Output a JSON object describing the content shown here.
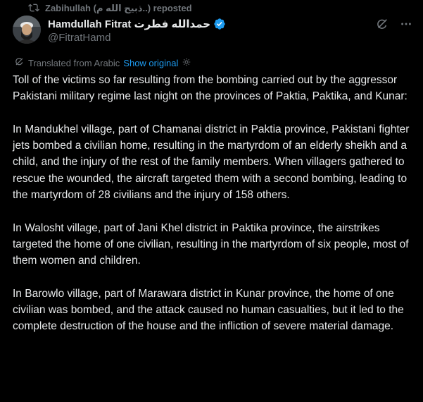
{
  "repost": {
    "text": "Zabihullah (ذبیح الله م..) reposted",
    "icon": "repost-icon"
  },
  "author": {
    "name": "Hamdullah Fitrat حمدالله فطرت",
    "handle": "@FitratHamd",
    "verified": true,
    "verified_color": "#1d9bf0"
  },
  "actions": {
    "grok_icon": "grok-icon",
    "more_icon": "more-icon"
  },
  "translation": {
    "label": "Translated from Arabic",
    "show_original": "Show original",
    "settings_icon": "gear-icon"
  },
  "paragraphs": [
    "Toll of the victims so far resulting from the bombing carried out by the aggressor Pakistani military regime last night on the provinces of Paktia, Paktika, and Kunar:",
    "In Mandukhel village, part of Chamanai district in Paktia province, Pakistani fighter jets bombed a civilian home, resulting in the martyrdom of an elderly sheikh and a child, and the injury of the rest of the family members. When villagers gathered to rescue the wounded, the aircraft targeted them with a second bombing, leading to the martyrdom of 28 civilians and the injury of 158 others.",
    "In Walosht village, part of Jani Khel district in Paktika province, the airstrikes targeted the home of one civilian, resulting in the martyrdom of six people, most of them women and children.",
    "In Barowlo village, part of Marawara district in Kunar province, the home of one civilian was bombed, and the attack caused no human casualties, but it led to the complete destruction of the house and the infliction of severe material damage."
  ],
  "colors": {
    "background": "#000000",
    "text": "#e7e9ea",
    "muted": "#71767b",
    "link": "#1d9bf0"
  }
}
